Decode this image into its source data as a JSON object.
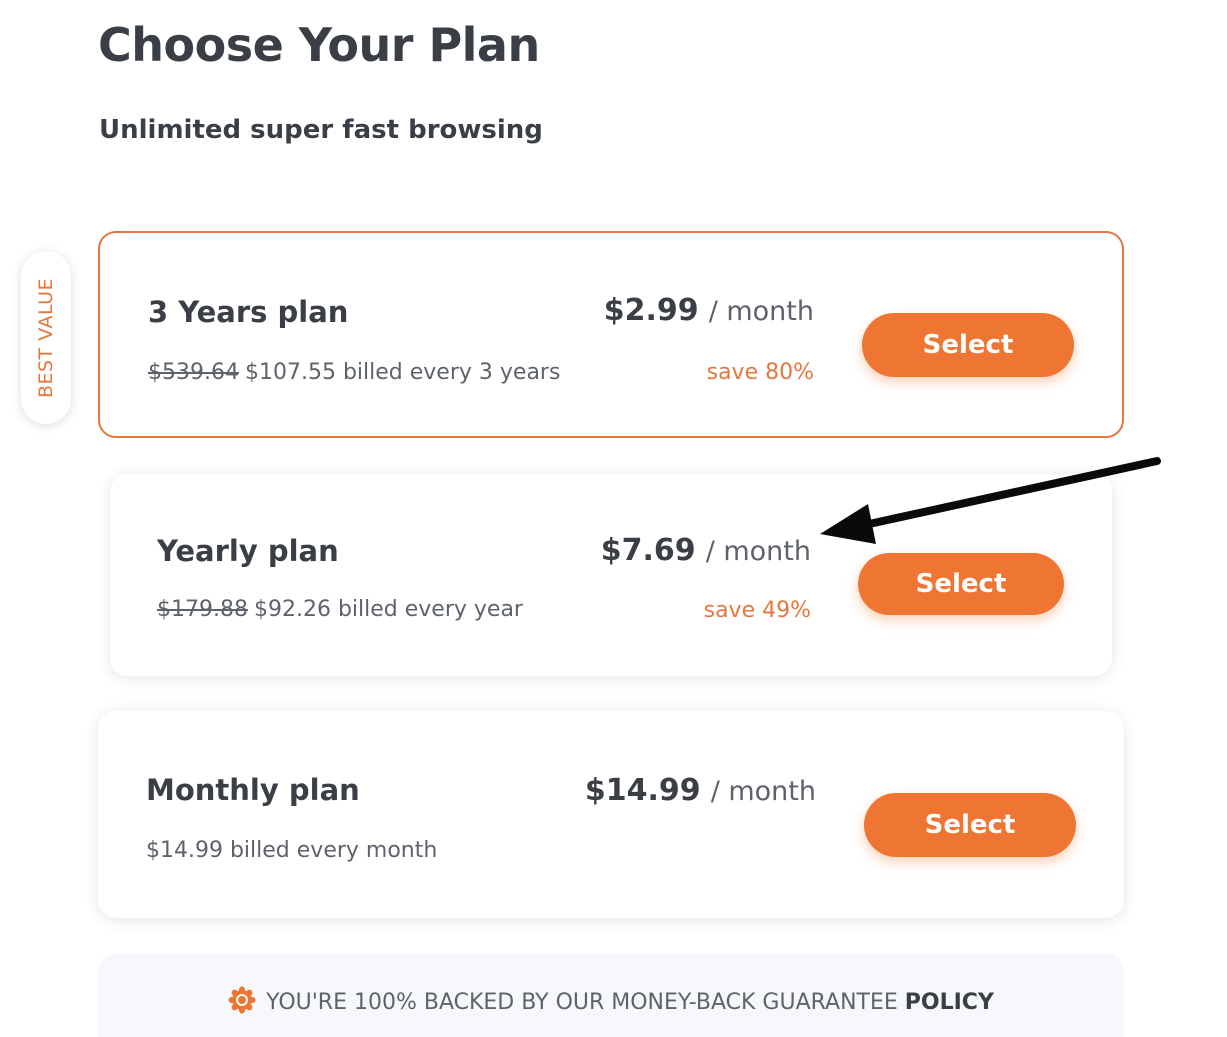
{
  "page": {
    "title": "Choose Your Plan",
    "subtitle": "Unlimited super fast browsing"
  },
  "best_value_label": "BEST VALUE",
  "plans": [
    {
      "name": "3 Years plan",
      "original_price": "$539.64",
      "billing": "$107.55 billed every 3 years",
      "price": "$2.99",
      "period": "/ month",
      "save": "save 80%",
      "select_label": "Select"
    },
    {
      "name": "Yearly plan",
      "original_price": "$179.88",
      "billing": "$92.26 billed every year",
      "price": "$7.69",
      "period": "/ month",
      "save": "save 49%",
      "select_label": "Select"
    },
    {
      "name": "Monthly plan",
      "billing": "$14.99 billed every month",
      "price": "$14.99",
      "period": "/ month",
      "select_label": "Select"
    }
  ],
  "guarantee": {
    "text": "YOU'RE 100% BACKED BY OUR MONEY-BACK GUARANTEE",
    "link": "POLICY",
    "icon": "badge-icon"
  },
  "colors": {
    "accent": "#ef7632",
    "accent_text": "#e4773d",
    "heading": "#3a3f46",
    "body": "#5e636b"
  }
}
